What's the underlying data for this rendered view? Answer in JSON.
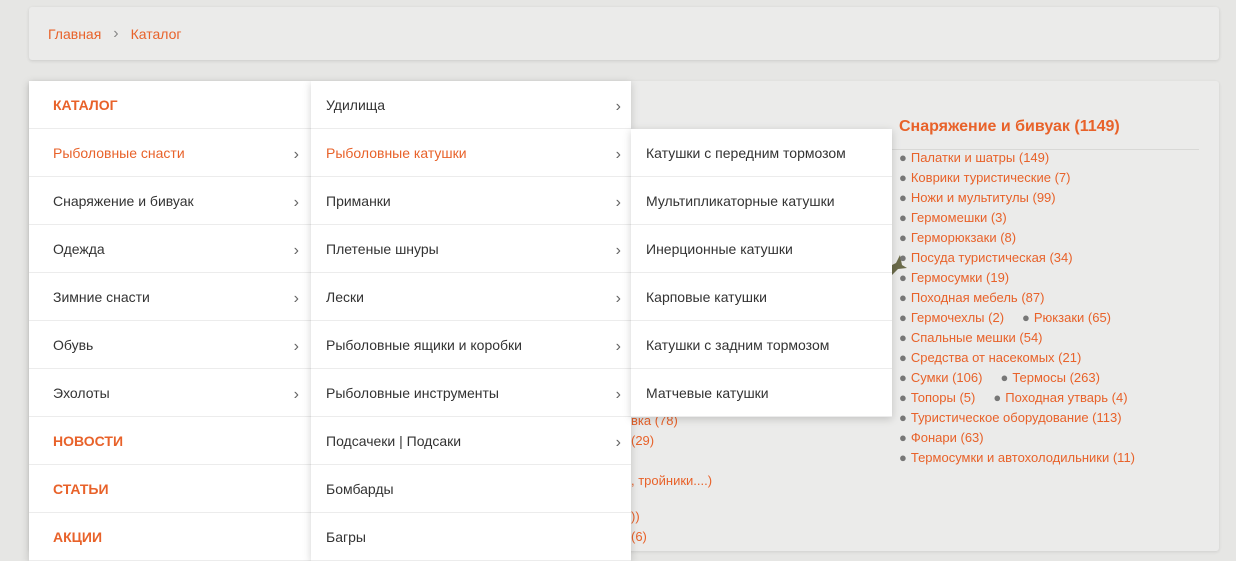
{
  "breadcrumb": {
    "home": "Главная",
    "separator": "›",
    "current": "Каталог"
  },
  "menu_level1": {
    "catalog": "КАТАЛОГ",
    "items": [
      "Рыболовные снасти",
      "Снаряжение и бивуак",
      "Одежда",
      "Зимние снасти",
      "Обувь",
      "Эхолоты"
    ],
    "news": "НОВОСТИ",
    "articles": "СТАТЬИ",
    "promos": "АКЦИИ"
  },
  "menu_level2": {
    "items": [
      "Удилища",
      "Рыболовные катушки",
      "Приманки",
      "Плетеные шнуры",
      "Лески",
      "Рыболовные ящики и коробки",
      "Рыболовные инструменты",
      "Подсачеки | Подсаки",
      "Бомбарды",
      "Багры"
    ]
  },
  "menu_level3": {
    "items": [
      "Катушки с передним тормозом",
      "Мультипликаторные катушки",
      "Инерционные катушки",
      "Карповые катушки",
      "Катушки с задним тормозом",
      "Матчевые катушки"
    ]
  },
  "chevron": "›",
  "bullet": "●",
  "content": {
    "section_title": "Снаряжение и бивуак (1149)",
    "items": [
      "Палатки и шатры (149)",
      "Коврики туристические (7)",
      "Ножи и мультитулы (99)",
      "Гермомешки (3)",
      "Герморюкзаки (8)",
      "Посуда туристическая (34)",
      "Гермосумки (19)",
      "Походная мебель (87)",
      [
        "Гермочехлы (2)",
        "Рюкзаки (65)"
      ],
      "Спальные мешки (54)",
      "Средства от насекомых (21)",
      [
        "Сумки (106)",
        "Термосы (263)"
      ],
      [
        "Топоры (5)",
        "Походная утварь (4)"
      ],
      "Туристическое оборудование (113)",
      "Фонари (63)",
      "Термосумки и автохолодильники (11)"
    ],
    "partial": [
      "вка (78)",
      "(29)",
      ", тройники....)",
      "))",
      "(6)"
    ]
  }
}
